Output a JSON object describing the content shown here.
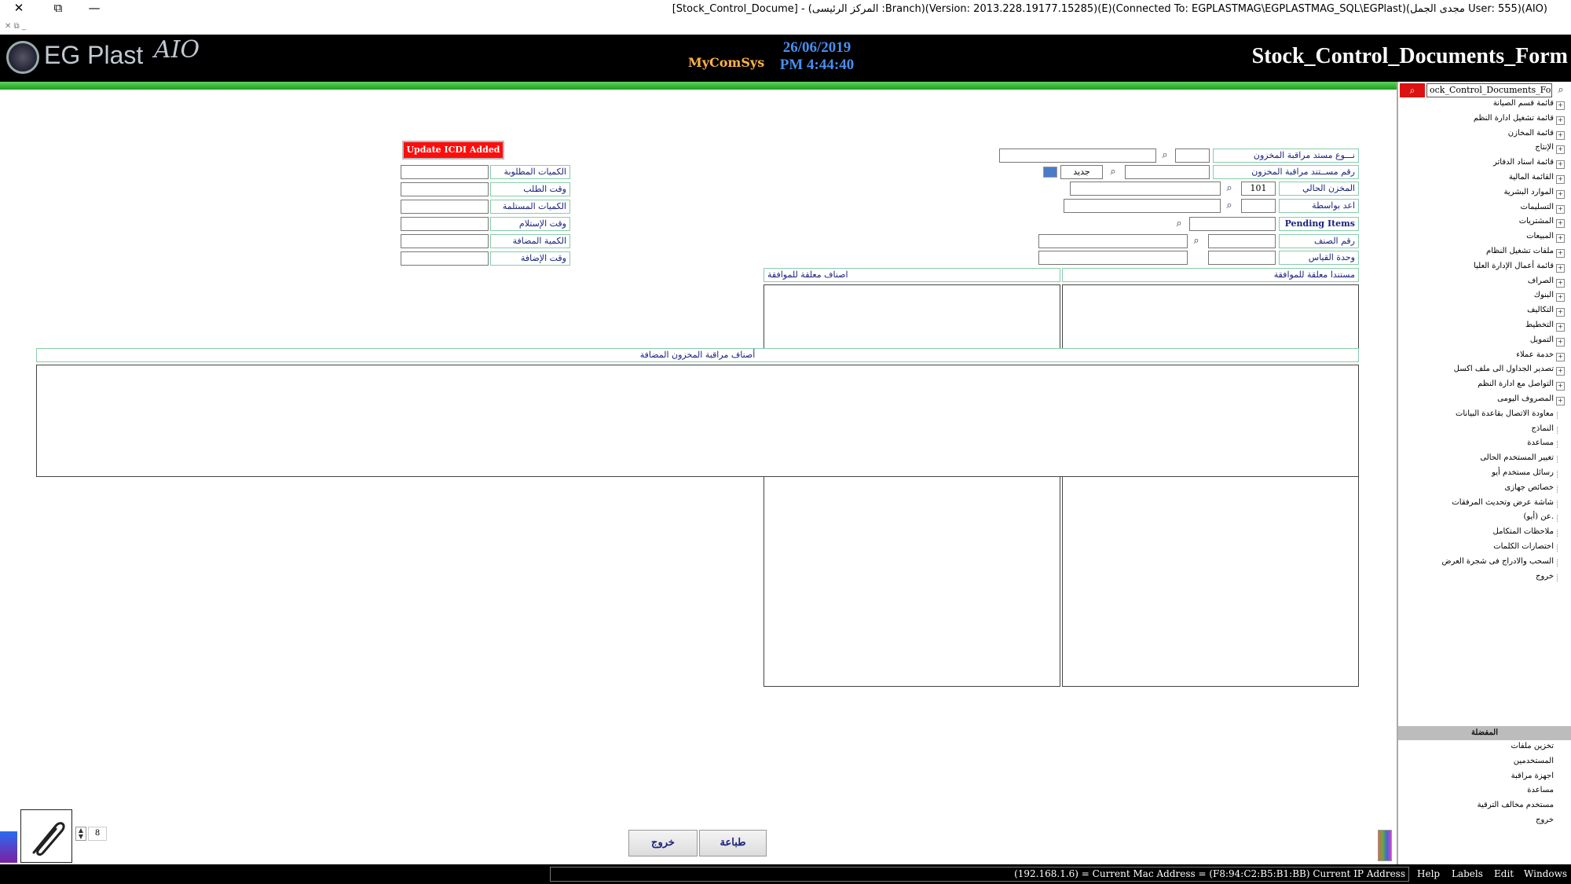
{
  "window": {
    "title": "[Stock_Control_Docume] - (المركز الرئيسى :Branch)(Version: 2013.228.19177.15285)(E)(Connected To: EGPLASTMAG\\EGPLASTMAG_SQL\\EGPlast)(مجدى الجمل User: 555)(AIO)",
    "close": "✕",
    "restore": "⧉",
    "minimize": "—",
    "sub_icons": "✕  ⧉  _"
  },
  "header": {
    "logo_text": "EG Plast",
    "logo_sub": "AIO",
    "brand": "MyComSys",
    "date": "26/06/2019",
    "time": "PM 4:44:40",
    "form_title": "Stock_Control_Documents_Form"
  },
  "form": {
    "doc_type_label": "نـــوع مستد مراقبة المخزون",
    "doc_no_label": "رقم مســتند مراقبة المخزون",
    "new_label": "جديد",
    "current_store_label": "المخزن الحالي",
    "current_store_value": "101",
    "prepared_by_label": "اعد بواسطة",
    "pending_items_label": "Pending Items",
    "item_no_label": "رقم الصنف",
    "unit_label": "وحدة القياس",
    "update_button": "Update ICDI Added",
    "required_qty_label": "الكميات المطلوبة",
    "request_time_label": "وقت الطلب",
    "received_qty_label": "الكميات المستلمة",
    "receive_time_label": "وقت الإستلام",
    "added_qty_label": "الكمية المضافة",
    "add_time_label": "وقت الإضافة",
    "pending_docs_header": "مستندا معلقة للموافقة",
    "pending_items_header": "اصناف معلقة للموافقة",
    "added_items_header": "أصناف مراقبة المخزون المضافة",
    "print_button": "طباعة",
    "exit_button": "خروج",
    "attach_count": "8"
  },
  "sidebar": {
    "search_value": "ock_Control_Documents_Form",
    "search_btn_icon": "search-icon",
    "tree": [
      {
        "label": "قائمة قسم الصيانة",
        "expandable": true
      },
      {
        "label": "قائمة تشغيل ادارة النظم",
        "expandable": true
      },
      {
        "label": "قائمة المخازن",
        "expandable": true
      },
      {
        "label": "الإنتاج",
        "expandable": true
      },
      {
        "label": "قائمة اسناد الدفاتر",
        "expandable": true
      },
      {
        "label": "القائمة المالية",
        "expandable": true
      },
      {
        "label": "الموارد البشرية",
        "expandable": true
      },
      {
        "label": "التسليمات",
        "expandable": true
      },
      {
        "label": "المشتريات",
        "expandable": true
      },
      {
        "label": "المبيعات",
        "expandable": true
      },
      {
        "label": "ملفات تشغيل النظام",
        "expandable": true
      },
      {
        "label": "قائمة أعمال الإدارة العليا",
        "expandable": true
      },
      {
        "label": "الصراف",
        "expandable": true
      },
      {
        "label": "البنوك",
        "expandable": true
      },
      {
        "label": "التكاليف",
        "expandable": true
      },
      {
        "label": "التخطيط",
        "expandable": true
      },
      {
        "label": "التمويل",
        "expandable": true
      },
      {
        "label": "خدمة عملاء",
        "expandable": true
      },
      {
        "label": "تصدير الجداول الى ملف اكسل",
        "expandable": true
      },
      {
        "label": "التواصل مع ادارة النظم",
        "expandable": true
      },
      {
        "label": "المصروف اليومى",
        "expandable": true
      },
      {
        "label": "معاودة الاتصال بقاعدة البيانات",
        "expandable": false
      },
      {
        "label": "النماذج",
        "expandable": false
      },
      {
        "label": "مساعدة",
        "expandable": false
      },
      {
        "label": "تغيير المستخدم الحالى",
        "expandable": false
      },
      {
        "label": "رسائل مستخدم أيو",
        "expandable": false
      },
      {
        "label": "خصائص جهازى",
        "expandable": false
      },
      {
        "label": "شاشة عرض وتحديث المرفقات",
        "expandable": false
      },
      {
        "label": "عن (أيو).",
        "expandable": false
      },
      {
        "label": "ملاحظات المتكامل",
        "expandable": false
      },
      {
        "label": "اختصارات الكلمات",
        "expandable": false
      },
      {
        "label": "السحب والادراج فى شجرة العرض",
        "expandable": false
      },
      {
        "label": "خروج",
        "expandable": false
      }
    ],
    "bottom_header": "المفضلة",
    "bottom_items": [
      {
        "label": "تخزين ملفات"
      },
      {
        "label": "المستخدمين"
      },
      {
        "label": "اجهزة مراقبة"
      },
      {
        "label": "مساعدة"
      },
      {
        "label": "مستخدم مخالف الترقية"
      },
      {
        "label": "خروج"
      }
    ]
  },
  "statusbar": {
    "text": "(192.168.1.6) = Current Mac Address = (F8:94:C2:B5:B1:BB) Current IP Address",
    "menus": [
      "Help",
      "Labels",
      "Edit",
      "Windows"
    ]
  },
  "colors": {
    "header_bg": "#000000",
    "accent_green": "#1e9e1e",
    "update_red": "#ff0d0d",
    "date_blue": "#4a8ef0",
    "label_text": "#1a237e"
  }
}
